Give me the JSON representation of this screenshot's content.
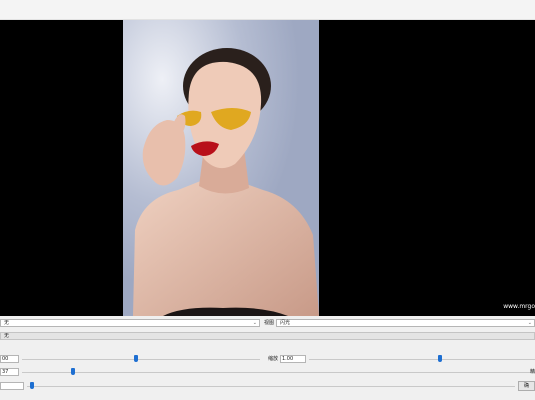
{
  "viewer": {
    "watermark": "www.mrgo"
  },
  "controls": {
    "mode_select": {
      "value": "无"
    },
    "view_label": "视图",
    "view_select": {
      "value": "闪光"
    },
    "bar_label": "无",
    "row1": {
      "left_value": "00",
      "left_slider": 0.48,
      "right_label": "缩放",
      "right_value": "1.00",
      "right_slider": 0.58
    },
    "row2": {
      "value": "37",
      "slider": 0.1
    },
    "row2_right_label": "精",
    "row3": {
      "value": "",
      "slider": 0.01,
      "button": "确"
    }
  }
}
